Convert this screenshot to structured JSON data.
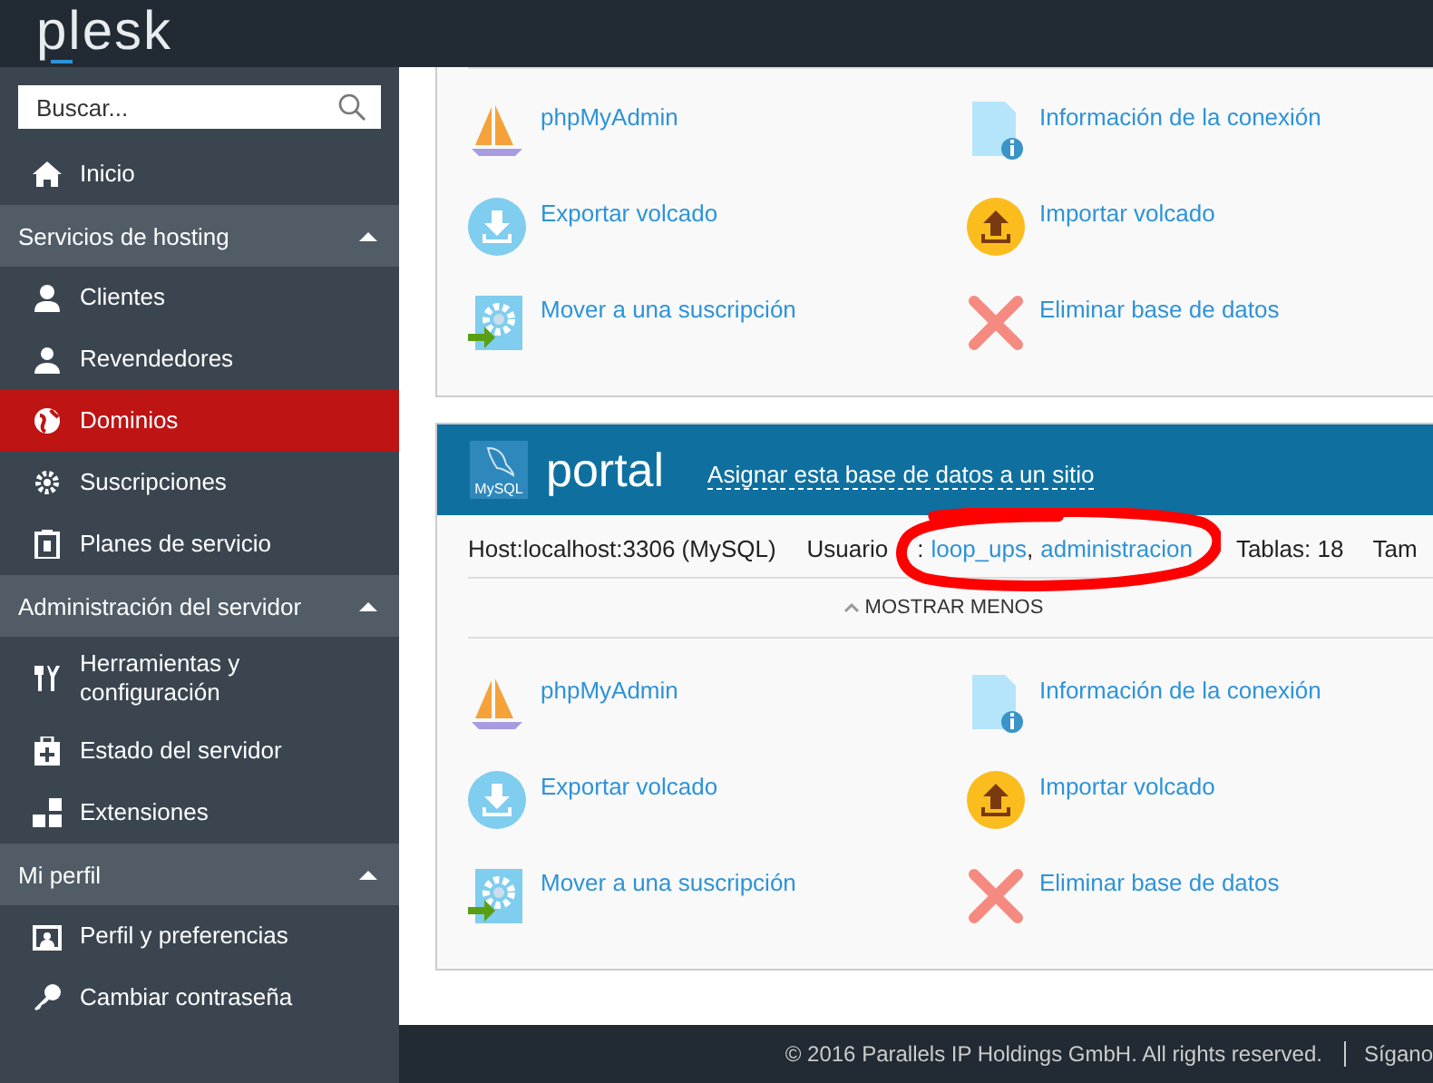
{
  "header": {
    "logo": "plesk"
  },
  "sidebar": {
    "search": {
      "placeholder": "Buscar..."
    },
    "items": [
      {
        "label": "Inicio",
        "selected": false
      }
    ],
    "sections": [
      {
        "title": "Servicios de hosting",
        "expanded": true,
        "items": [
          {
            "label": "Clientes",
            "selected": false
          },
          {
            "label": "Revendedores",
            "selected": false
          },
          {
            "label": "Dominios",
            "selected": true
          },
          {
            "label": "Suscripciones",
            "selected": false
          },
          {
            "label": "Planes de servicio",
            "selected": false
          }
        ]
      },
      {
        "title": "Administración del servidor",
        "expanded": true,
        "items": [
          {
            "label": "Herramientas y configuración",
            "selected": false
          },
          {
            "label": "Estado del servidor",
            "selected": false
          },
          {
            "label": "Extensiones",
            "selected": false
          }
        ]
      },
      {
        "title": "Mi perfil",
        "expanded": true,
        "items": [
          {
            "label": "Perfil y preferencias",
            "selected": false
          },
          {
            "label": "Cambiar contraseña",
            "selected": false
          }
        ]
      }
    ]
  },
  "databases": [
    {
      "actions": [
        "phpMyAdmin",
        "Información de la conexión",
        "Exportar volcado",
        "Importar volcado",
        "Mover a una suscripción",
        "Eliminar base de datos"
      ]
    },
    {
      "header": {
        "name": "portal",
        "logo_text": "MySQL",
        "assign_link": "Asignar esta base de datos a un sitio"
      },
      "details": {
        "host": "Host:localhost:3306 (MySQL)",
        "users": {
          "label": "Usuario",
          "separator": ":",
          "names": [
            "loop_ups",
            "administracion"
          ],
          "joiner": ",",
          "circled": true
        },
        "tables": "Tablas: 18",
        "size": "Tam"
      },
      "toggle": {
        "label": "MOSTRAR MENOS",
        "expanded": true
      },
      "actions": [
        "phpMyAdmin",
        "Información de la conexión",
        "Exportar volcado",
        "Importar volcado",
        "Mover a una suscripción",
        "Eliminar base de datos"
      ]
    }
  ],
  "footer": {
    "copyright": "© 2016 Parallels IP Holdings GmbH. All rights reserved.",
    "follow": "Sígano"
  }
}
